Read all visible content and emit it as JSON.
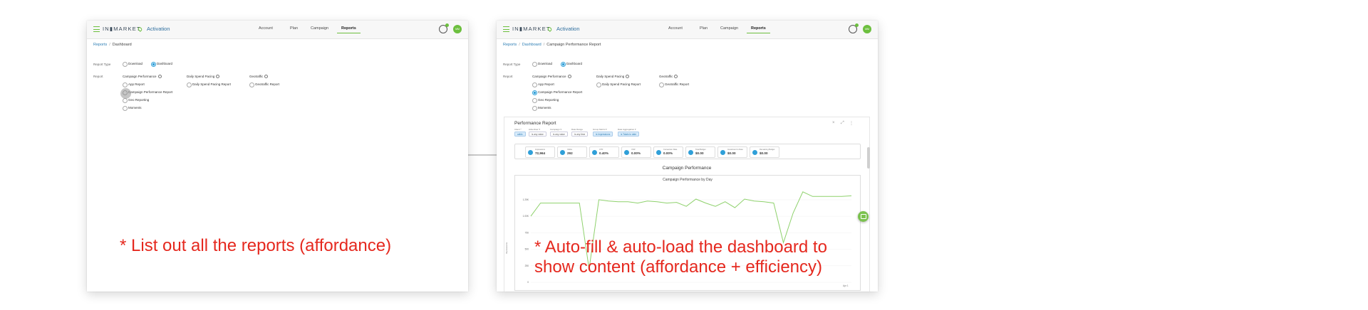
{
  "app": {
    "brand": "IN▮MARKET",
    "product": "Activation",
    "nav": [
      "Account",
      "Plan",
      "Campaign",
      "Reports"
    ],
    "active_nav": "Reports",
    "avatar_initials": "MM",
    "accent_color": "#6cbf3e",
    "link_color": "#2f7fb5"
  },
  "screen1": {
    "breadcrumb": [
      "Reports",
      "Dashboard"
    ],
    "report_type_label": "Report Type",
    "report_type_options": [
      "Download",
      "Dashboard"
    ],
    "report_type_selected": "Dashboard",
    "report_label": "Report",
    "groups": [
      {
        "title": "Campaign Performance",
        "options": [
          "App Report",
          "Campaign Performance Report",
          "Geo Reporting",
          "Moments"
        ]
      },
      {
        "title": "Daily Spend Pacing",
        "options": [
          "Daily Spend Pacing Report"
        ]
      },
      {
        "title": "Geotraffic",
        "options": [
          "Geotraffic Report"
        ]
      }
    ],
    "annotation": "* List out all the reports (affordance)"
  },
  "screen2": {
    "breadcrumb": [
      "Reports",
      "Dashboard",
      "Campaign Performance Report"
    ],
    "report_type_label": "Report Type",
    "report_type_options": [
      "Download",
      "Dashboard"
    ],
    "report_type_selected": "Dashboard",
    "report_label": "Report",
    "groups": [
      {
        "title": "Campaign Performance",
        "options": [
          "App Report",
          "Campaign Performance Report",
          "Geo Reporting",
          "Moments"
        ]
      },
      {
        "title": "Daily Spend Pacing",
        "options": [
          "Daily Spend Pacing Report"
        ]
      },
      {
        "title": "Geotraffic",
        "options": [
          "Geotraffic Report"
        ]
      }
    ],
    "selected_report": "Campaign Performance Report",
    "panel": {
      "title": "Performance Report",
      "controls": [
        "×",
        "⤢",
        "⋮"
      ],
      "filters": [
        {
          "label": "Client *",
          "value": "adidx",
          "highlight": true
        },
        {
          "label": "Advertiser  ▾",
          "value": "is any value",
          "highlight": false
        },
        {
          "label": "Campaign  ▾",
          "value": "is any value",
          "highlight": false
        },
        {
          "label": "Date Range",
          "value": "is any time",
          "highlight": false
        },
        {
          "label": "Group Metric ▾",
          "value": "is Impressions",
          "highlight": true
        },
        {
          "label": "Date Aggregation ▾",
          "value": "is Totals to date",
          "highlight": true
        }
      ],
      "kpis": [
        {
          "label": "Impressions",
          "value": "72,964"
        },
        {
          "label": "Clicks",
          "value": "292"
        },
        {
          "label": "CTR",
          "value": "0.40%"
        },
        {
          "label": "VCR",
          "value": "0.00%"
        },
        {
          "label": "Conversion Rate",
          "value": "0.00%"
        },
        {
          "label": "Total Budget",
          "value": "$0.00"
        },
        {
          "label": "Investment to Date",
          "value": "$0.00"
        },
        {
          "label": "Remaining Budget",
          "value": "$0.00"
        }
      ],
      "section_title": "Campaign Performance"
    },
    "annotation_line1": "* Auto-fill & auto-load the dashboard to",
    "annotation_line2": "show content (affordance + efficiency)"
  },
  "chart_data": {
    "type": "line",
    "title": "Campaign Performance by Day",
    "ylabel": "Impressions",
    "yticks": [
      "1.25K",
      "1.00K",
      "750",
      "500",
      "250",
      "0"
    ],
    "ylim": [
      0,
      1400
    ],
    "x_last_label": "Apr 1",
    "series": [
      {
        "color": "#8ed16c",
        "values": [
          1000,
          1200,
          1200,
          1200,
          1200,
          1200,
          200,
          1250,
          1230,
          1220,
          1220,
          1200,
          1230,
          1220,
          1200,
          1210,
          1150,
          1260,
          1200,
          1150,
          1220,
          1130,
          1260,
          1230,
          1220,
          1200,
          600,
          1050,
          1370,
          1300,
          1300,
          1300,
          1300,
          1310
        ]
      }
    ]
  }
}
